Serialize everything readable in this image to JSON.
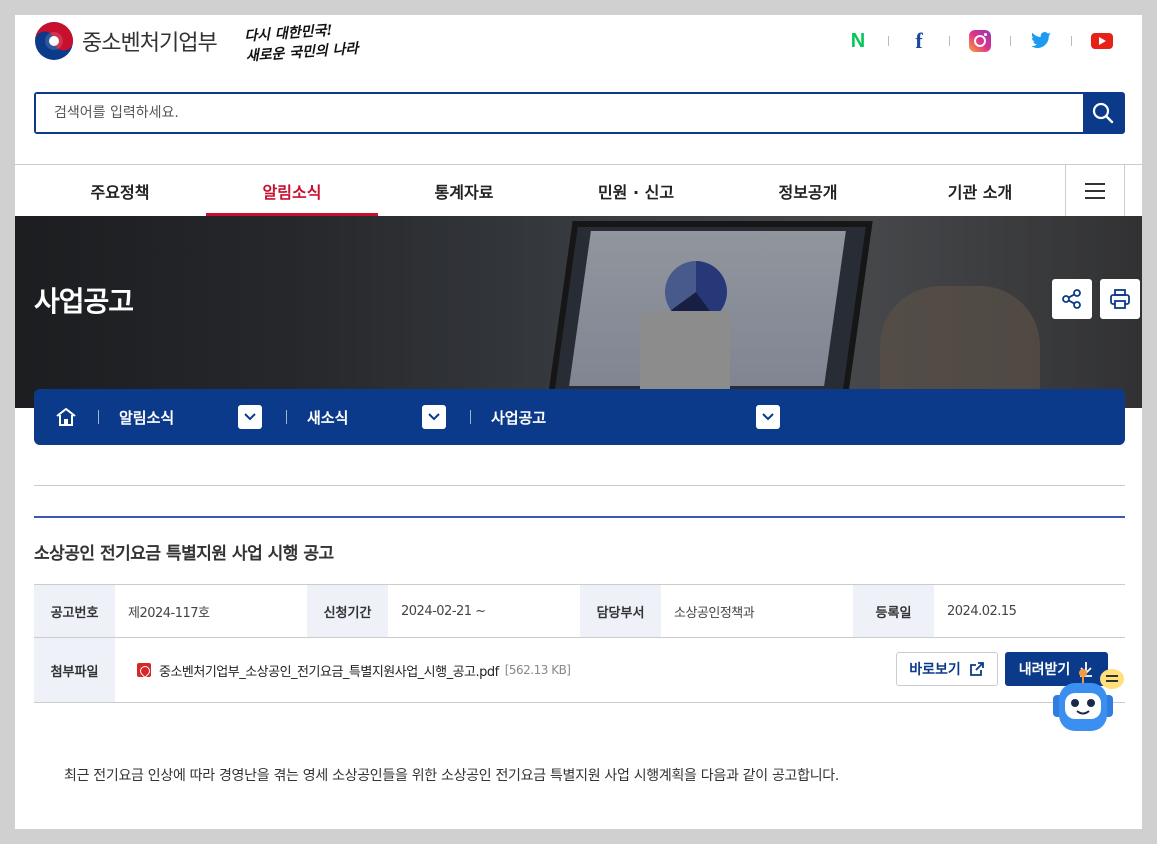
{
  "header": {
    "ministry_name": "중소벤처기업부",
    "slogan_line1": "다시 대한민국!",
    "slogan_line2": "새로운 국민의 나라",
    "sns": [
      {
        "name": "naver",
        "glyph": "N"
      },
      {
        "name": "facebook",
        "glyph": "f"
      },
      {
        "name": "instagram"
      },
      {
        "name": "twitter"
      },
      {
        "name": "youtube"
      }
    ]
  },
  "search": {
    "placeholder": "검색어를 입력하세요."
  },
  "nav": {
    "items": [
      {
        "label": "주요정책",
        "active": false
      },
      {
        "label": "알림소식",
        "active": true
      },
      {
        "label": "통계자료",
        "active": false
      },
      {
        "label": "민원 · 신고",
        "active": false
      },
      {
        "label": "정보공개",
        "active": false
      },
      {
        "label": "기관 소개",
        "active": false
      }
    ]
  },
  "hero": {
    "title": "사업공고"
  },
  "breadcrumb": {
    "items": [
      "알림소식",
      "새소식",
      "사업공고"
    ]
  },
  "post": {
    "title": "소상공인 전기요금 특별지원 사업 시행 공고",
    "info": {
      "notice_no_label": "공고번호",
      "notice_no": "제2024-117호",
      "period_label": "신청기간",
      "period": "2024-02-21 ~",
      "dept_label": "담당부서",
      "dept": "소상공인정책과",
      "date_label": "등록일",
      "date": "2024.02.15",
      "attach_label": "첨부파일",
      "file_name": "중소벤처기업부_소상공인_전기요금_특별지원사업_시행_공고.pdf",
      "file_size": "[562.13 KB]",
      "view_label": "바로보기",
      "download_label": "내려받기"
    },
    "body": "최근 전기요금 인상에 따라 경영난을 겪는 영세 소상공인들을 위한 소상공인 전기요금 특별지원 사업 시행계획을 다음과 같이 공고합니다."
  },
  "colors": {
    "primary": "#0b3a8a",
    "accent": "#c8102e",
    "table_header_bg": "#eef2f8"
  }
}
